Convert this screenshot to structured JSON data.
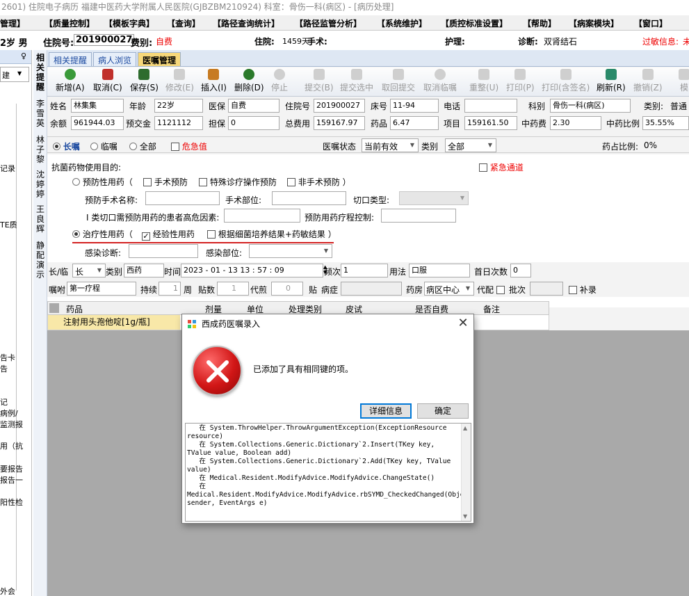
{
  "window": {
    "title": "2601) 住院电子病历  福建中医药大学附属人民医院(GJBZBM210924)  科室：骨伤一科(病区) - [病历处理]"
  },
  "menu": [
    "管理】",
    "【质量控制】",
    "【模板字典】",
    "【查询】",
    "【路径查询统计】",
    "【路径监管分析】",
    "【系统维护】",
    "【质控标准设置】",
    "【帮助】",
    "【病案模块】",
    "【窗口】"
  ],
  "patient_bar": {
    "age_sex": "2岁 男",
    "inpatient_label": "住院号:",
    "inpatient_no": "201900027",
    "fee_label": "费别:",
    "fee_value": "自费",
    "hospital_label": "住院:",
    "hospital_days": "1459天",
    "surgery_label": "手术:",
    "nursing_label": "护理:",
    "diagnosis_label": "诊断:",
    "diagnosis_value": "双肾结石",
    "allergy_label": "过敏信息:",
    "allergy_value": "未"
  },
  "left_panel": {
    "combo_text": "建",
    "pin": "♀",
    "items": [
      "记录",
      "TE质",
      "告卡",
      "告",
      "记",
      "病例/",
      "监测报",
      "用（抗",
      "要报告",
      "报告一",
      "阳性检",
      "外会"
    ]
  },
  "vertical_strip": [
    "相关提醒",
    "李雪英",
    "林子黎",
    "沈婷婷",
    "王良辉",
    "静配演示"
  ],
  "tabs": [
    "相关提醒",
    "病人浏览",
    "医嘱管理"
  ],
  "toolbar": {
    "buttons": [
      {
        "label": "新增(A)",
        "icon": "add-icon",
        "enabled": true
      },
      {
        "label": "取消(C)",
        "icon": "undo-icon",
        "enabled": true
      },
      {
        "label": "保存(S)",
        "icon": "save-icon",
        "enabled": true
      },
      {
        "label": "修改(E)",
        "icon": "edit-icon",
        "enabled": false
      },
      {
        "label": "插入(I)",
        "icon": "insert-icon",
        "enabled": true
      },
      {
        "label": "删除(D)",
        "icon": "delete-icon",
        "enabled": true
      },
      {
        "label": "停止",
        "icon": "stop-icon",
        "enabled": false
      },
      {
        "label": "提交(B)",
        "icon": "submit-icon",
        "enabled": false
      },
      {
        "label": "提交选中",
        "icon": "submit-selected-icon",
        "enabled": false
      },
      {
        "label": "取回提交",
        "icon": "retrieve-icon",
        "enabled": false
      },
      {
        "label": "取消临嘱",
        "icon": "cancel-temp-icon",
        "enabled": false
      },
      {
        "label": "重整(U)",
        "icon": "reorganize-icon",
        "enabled": false
      },
      {
        "label": "打印(P)",
        "icon": "print-icon",
        "enabled": false
      },
      {
        "label": "打印(含签名)",
        "icon": "print-sign-icon",
        "enabled": false
      },
      {
        "label": "刷新(R)",
        "icon": "refresh-icon",
        "enabled": true
      },
      {
        "label": "撤销(Z)",
        "icon": "revoke-icon",
        "enabled": false
      },
      {
        "label": "模",
        "icon": "template-icon",
        "enabled": false
      }
    ]
  },
  "patient_info": {
    "name_label": "姓名",
    "name": "林集集",
    "age_label": "年龄",
    "age": "22岁",
    "insurance_label": "医保",
    "insurance": "自费",
    "inpatient_label": "住院号",
    "inpatient_no": "201900027",
    "bed_label": "床号",
    "bed": "11-94",
    "phone_label": "电话",
    "phone": "",
    "dept_label": "科别",
    "dept": "骨伤一科(病区)",
    "category_label": "类别:",
    "category": "普通",
    "balance_label": "余额",
    "balance": "961944.03",
    "deposit_label": "预交金",
    "deposit": "1121112",
    "guarantee_label": "担保",
    "guarantee": "0",
    "total_label": "总费用",
    "total": "159167.97",
    "drug_label": "药品",
    "drug": "6.47",
    "item_label": "项目",
    "item": "159161.50",
    "tcm_fee_label": "中药费",
    "tcm_fee": "2.30",
    "tcm_ratio_label": "中药比例",
    "tcm_ratio": "35.55%"
  },
  "filter": {
    "long_term": "长嘱",
    "temporary": "临嘱",
    "all": "全部",
    "critical": "危急值",
    "status_label": "医嘱状态",
    "status_value": "当前有效",
    "type_label": "类别",
    "type_value": "全部",
    "drug_ratio_label": "药占比例:",
    "drug_ratio": "0%"
  },
  "antibiotic": {
    "purpose_label": "抗菌药物使用目的:",
    "emergency": "紧急通道",
    "prophylactic": "预防性用药（",
    "surgical_prevention": "手术预防",
    "special_procedure": "特殊诊疗操作预防",
    "non_surgical": "非手术预防  ）",
    "prevent_surgery_name": "预防手术名称:",
    "surgery_site": "手术部位:",
    "incision_type": "切口类型:",
    "class1_risk": "I 类切口需预防用药的患者高危因素:",
    "prevent_course": "预防用药疗程控制:",
    "therapeutic": "治疗性用药（",
    "empirical": "经验性用药",
    "culture_based": "根据细菌培养结果+药敏结果  ）",
    "infection_diag": "感染诊断:",
    "infection_site": "感染部位:"
  },
  "order": {
    "lt_label": "长/临",
    "lt_value": "长",
    "cat_label": "类别",
    "cat_value": "西药",
    "time_label": "时间",
    "time_value": "2023 - 01 - 13   13 : 57 : 09",
    "freq_label": "频次",
    "freq_value": "1",
    "usage_label": "用法",
    "usage_value": "口服",
    "first_day_label": "首日次数",
    "first_day_value": "0",
    "note_label": "嘱咐",
    "note_value": "第一疗程",
    "duration_label": "持续",
    "duration_value": "1",
    "week_label": "周",
    "paste_label": "贴数",
    "paste_value": "1",
    "daijian_label": "代煎",
    "daijian_value": "0",
    "tie_label": "贴",
    "disease_label": "病症",
    "pharmacy_label": "药房",
    "pharmacy_value": "病区中心",
    "daipei_label": "代配",
    "batch_label": "批次",
    "supplement_label": "补录"
  },
  "grid": {
    "columns": [
      "药品",
      "剂量",
      "单位",
      "处理类别",
      "皮试",
      "是否自费",
      "备注"
    ],
    "rows": [
      [
        "注射用头孢他啶[1g/瓶]",
        "",
        "",
        "",
        "",
        "",
        ""
      ]
    ]
  },
  "dialog": {
    "title": "西成药医嘱录入",
    "message": "已添加了具有相同键的项。",
    "details_button": "详细信息",
    "ok_button": "确定",
    "details": "   在 System.ThrowHelper.ThrowArgumentException(ExceptionResource resource)\n   在 System.Collections.Generic.Dictionary`2.Insert(TKey key, TValue value, Boolean add)\n   在 System.Collections.Generic.Dictionary`2.Add(TKey key, TValue value)\n   在 Medical.Resident.ModifyAdvice.ModifyAdvice.ChangeState()\n   在\nMedical.Resident.ModifyAdvice.ModifyAdvice.rbSYMD_CheckedChanged(Object sender, EventArgs e)"
  },
  "colors": {
    "tab_active": "#f6d77a",
    "grid_highlight": "#f8e8a8",
    "error_red": "#d11616",
    "alert_red": "#e00000"
  }
}
